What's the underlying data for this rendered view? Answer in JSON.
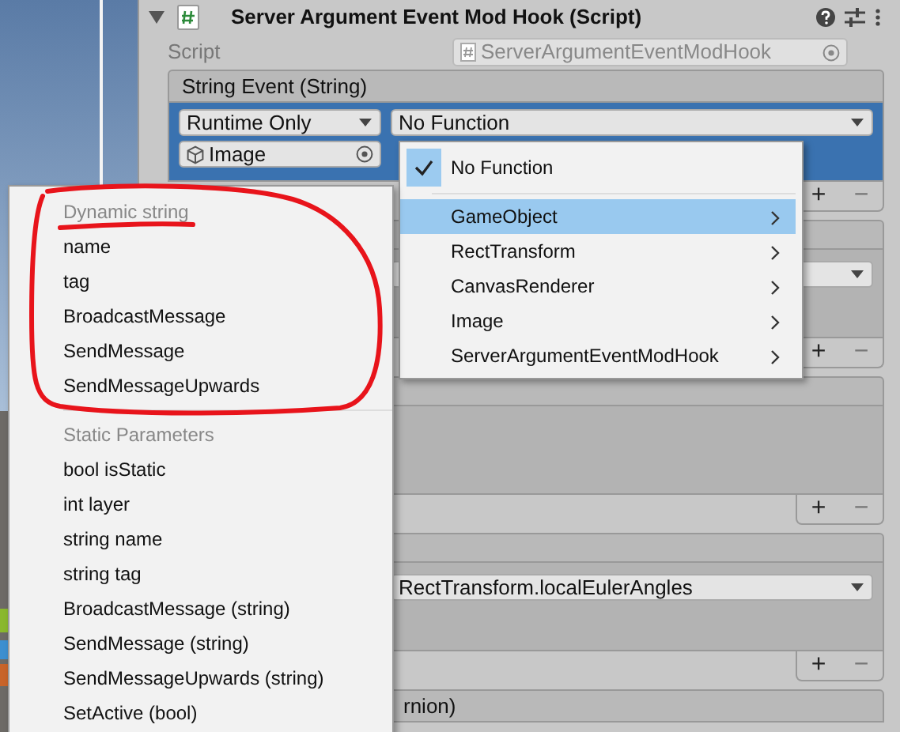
{
  "component": {
    "title": "Server Argument Event Mod Hook (Script)",
    "expanded": true
  },
  "script_field": {
    "label": "Script",
    "value": "ServerArgumentEventModHook"
  },
  "events": [
    {
      "kind": "selected-call",
      "header": "String Event (String)",
      "mode": "Runtime Only",
      "function": "No Function",
      "target": "Image",
      "add": "+",
      "remove": "−"
    },
    {
      "kind": "call",
      "add": "+",
      "remove": "−"
    },
    {
      "kind": "empty",
      "add": "+",
      "remove": "−"
    },
    {
      "kind": "call",
      "function": "RectTransform.localEulerAngles",
      "add": "+",
      "remove": "−"
    },
    {
      "kind": "header-only",
      "header": "rnion)"
    }
  ],
  "function_menu": {
    "items": [
      {
        "kind": "option",
        "label": "No Function",
        "checked": true
      },
      {
        "kind": "separator"
      },
      {
        "kind": "submenu",
        "label": "GameObject",
        "selected": true
      },
      {
        "kind": "submenu",
        "label": "RectTransform",
        "selected": false
      },
      {
        "kind": "submenu",
        "label": "CanvasRenderer",
        "selected": false
      },
      {
        "kind": "submenu",
        "label": "Image",
        "selected": false
      },
      {
        "kind": "submenu",
        "label": "ServerArgumentEventModHook",
        "selected": false
      }
    ]
  },
  "submenu": {
    "sections": [
      {
        "header": "Dynamic string",
        "items": [
          "name",
          "tag",
          "BroadcastMessage",
          "SendMessage",
          "SendMessageUpwards"
        ]
      },
      {
        "header": "Static Parameters",
        "items": [
          "bool isStatic",
          "int layer",
          "string name",
          "string tag",
          "BroadcastMessage (string)",
          "SendMessage (string)",
          "SendMessageUpwards (string)",
          "SetActive (bool)"
        ]
      }
    ]
  }
}
